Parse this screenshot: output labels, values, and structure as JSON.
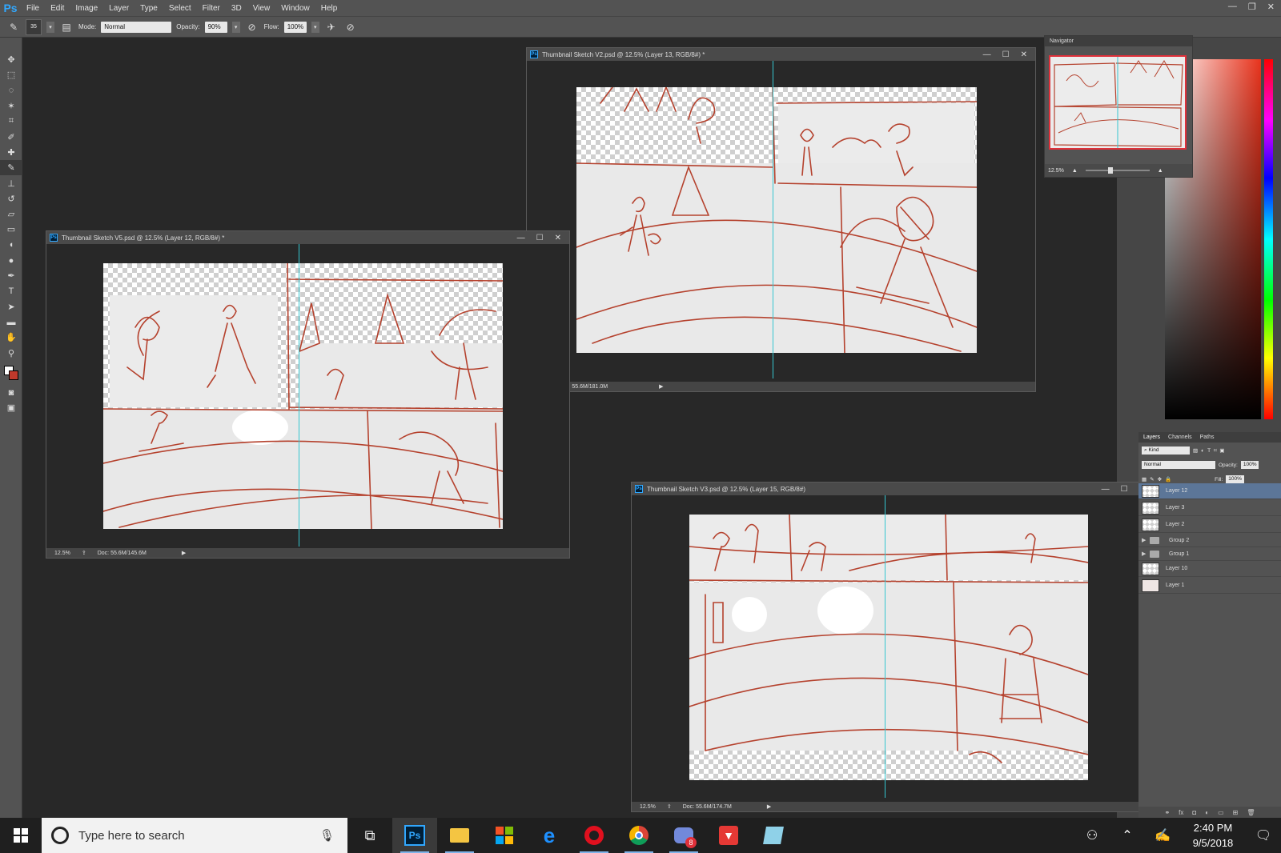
{
  "app": {
    "logo": "Ps"
  },
  "menu": [
    "File",
    "Edit",
    "Image",
    "Layer",
    "Type",
    "Select",
    "Filter",
    "3D",
    "View",
    "Window",
    "Help"
  ],
  "options": {
    "brush_size": "35",
    "mode_label": "Mode:",
    "mode_value": "Normal",
    "opacity_label": "Opacity:",
    "opacity_value": "90%",
    "flow_label": "Flow:",
    "flow_value": "100%"
  },
  "documents": {
    "v5": {
      "title": "Thumbnail Sketch V5.psd @ 12.5% (Layer 12, RGB/8#) *",
      "zoom": "12.5%",
      "doc_size": "Doc: 55.6M/145.6M"
    },
    "v2": {
      "title": "Thumbnail Sketch V2.psd @ 12.5% (Layer 13, RGB/8#) *",
      "doc_size": "Doc: 55.6M/181.0M"
    },
    "v3": {
      "title": "Thumbnail Sketch V3.psd @ 12.5% (Layer 15, RGB/8#)",
      "zoom": "12.5%",
      "doc_size": "Doc: 55.6M/174.7M"
    }
  },
  "navigator": {
    "tab": "Navigator",
    "zoom": "12.5%"
  },
  "layers_panel": {
    "tabs": [
      "Layers",
      "Channels",
      "Paths"
    ],
    "kind_label": "Kind",
    "blend_mode": "Normal",
    "opacity_label": "Opacity:",
    "opacity_value": "100%",
    "fill_label": "Fill:",
    "fill_value": "100%",
    "layers": [
      {
        "name": "Layer 12",
        "type": "layer",
        "selected": true
      },
      {
        "name": "Layer 3",
        "type": "layer",
        "selected": false
      },
      {
        "name": "Layer 2",
        "type": "layer",
        "selected": false
      },
      {
        "name": "Group 2",
        "type": "group",
        "selected": false
      },
      {
        "name": "Group 1",
        "type": "group",
        "selected": false
      },
      {
        "name": "Layer 10",
        "type": "layer",
        "selected": false
      },
      {
        "name": "Layer 1",
        "type": "layer",
        "selected": false
      }
    ]
  },
  "taskbar": {
    "search_placeholder": "Type here to search",
    "badge_count": "8",
    "time": "2:40 PM",
    "date": "9/5/2018"
  },
  "colors": {
    "accent_selection": "#5c7698",
    "sketch_line": "#b5422e",
    "guide": "#35c6d0"
  }
}
